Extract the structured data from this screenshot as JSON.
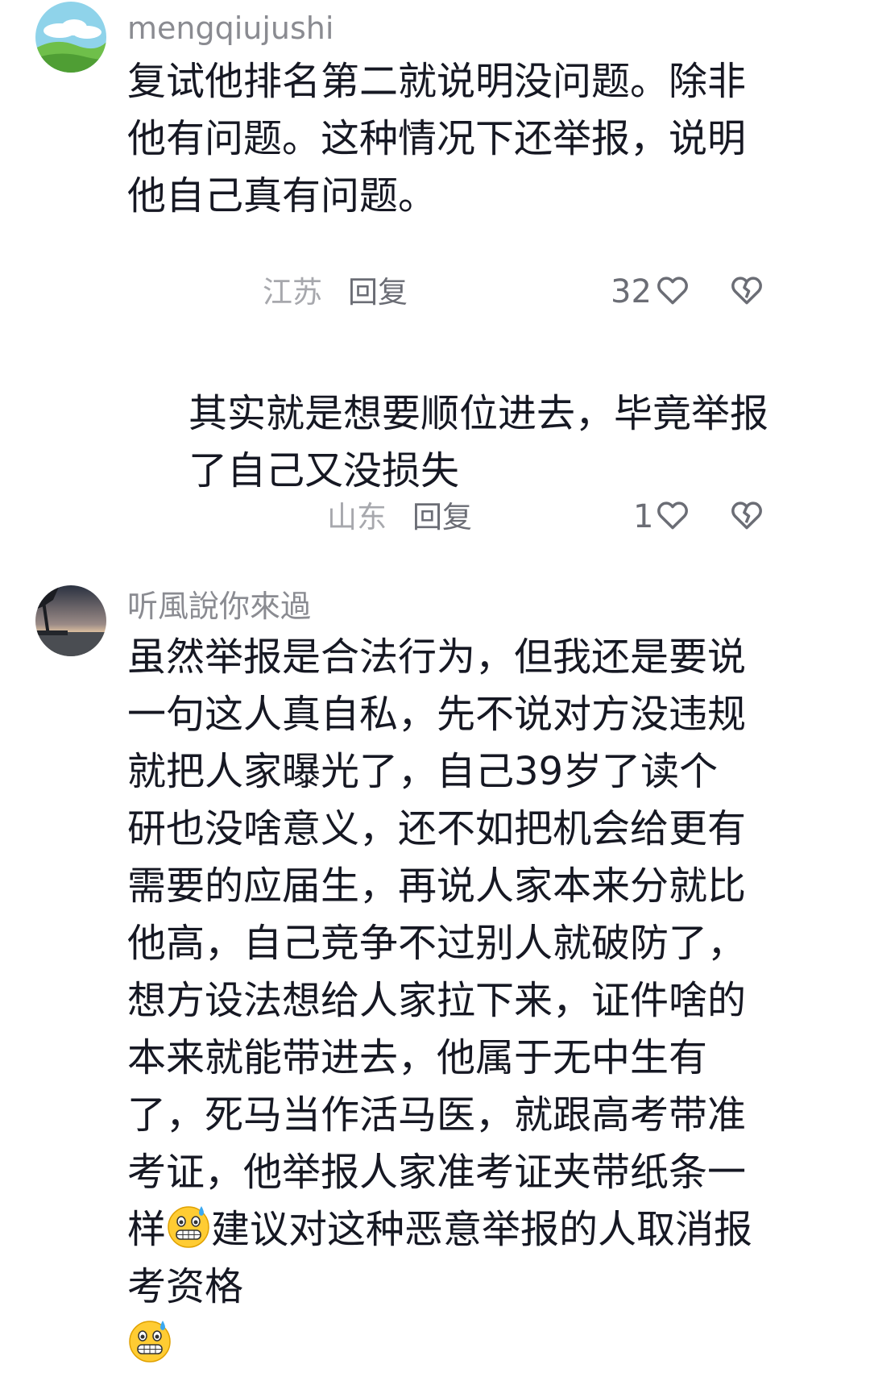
{
  "comments": [
    {
      "username": "mengqiujushi",
      "text": "复试他排名第二就说明没问题。除非他有问题。这种情况下还举报，说明他自己真有问题。",
      "location": "江苏",
      "reply_label": "回复",
      "like_count": "32",
      "avatar_icon": "landscape-avatar-icon"
    },
    {
      "username": "",
      "text": "其实就是想要顺位进去，毕竟举报了自己又没损失",
      "location": "山东",
      "reply_label": "回复",
      "like_count": "1"
    },
    {
      "username": "听風說你來過",
      "text_part1": "虽然举报是合法行为，但我还是要说一句这人真自私，先不说对方没违规就把人家曝光了，自己39岁了读个研也没啥意义，还不如把机会给更有需要的应届生，再说人家本来分就比他高，自己竞争不过别人就破防了，想方设法想给人家拉下来，证件啥的本来就能带进去，他属于无中生有了，死马当作活马医，就跟高考带准考证，他举报人家准考证夹带纸条一样",
      "text_part2": "建议对这种恶意举报的人取消报考资格",
      "emoji_name": "grimacing-sweat-emoji",
      "avatar_icon": "sunset-avatar-icon"
    }
  ],
  "icons": {
    "like": "heart-outline-icon",
    "dislike": "broken-heart-icon"
  },
  "colors": {
    "text": "#161823",
    "username": "#8a8b91",
    "location": "#a7a8ad",
    "reply": "#6b6d75"
  }
}
